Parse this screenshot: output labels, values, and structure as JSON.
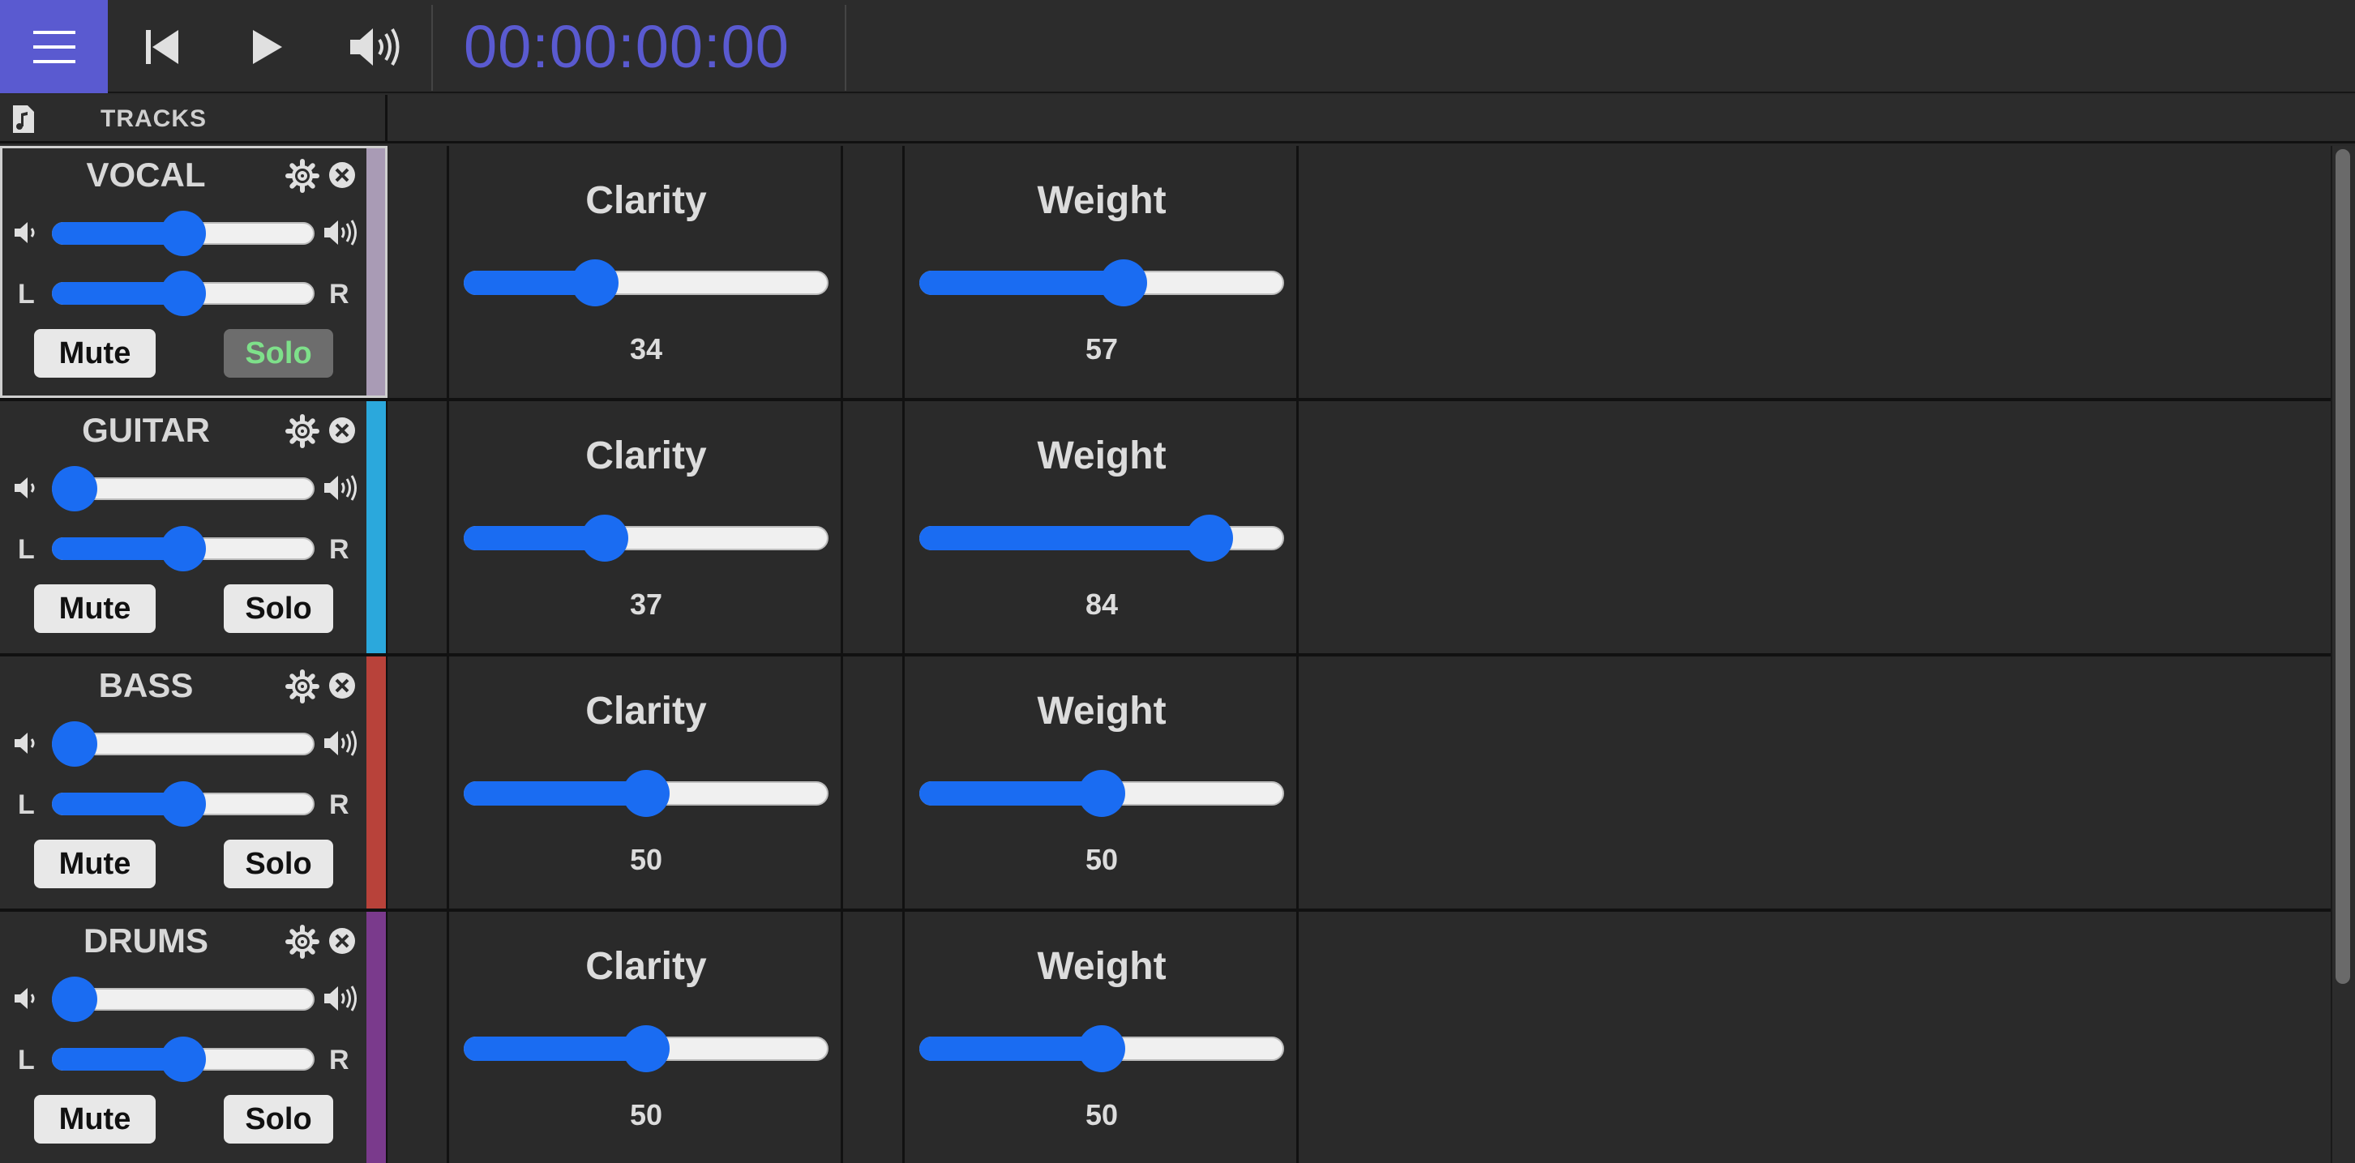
{
  "toolbar": {
    "menu_icon": "hamburger-icon",
    "skip_back_icon": "skip-back-icon",
    "play_icon": "play-icon",
    "volume_icon": "volume-icon",
    "timecode": "00:00:00:00",
    "accent": "#5a5ad0"
  },
  "header": {
    "tracks_icon": "music-file-icon",
    "tracks_label": "TRACKS"
  },
  "tracks": [
    {
      "name": "VOCAL",
      "color": "#a99bb5",
      "volume": 0.5,
      "pan": 0.5,
      "mute_label": "Mute",
      "solo_label": "Solo",
      "solo_active": true,
      "selected": true,
      "clarity": {
        "title": "Clarity",
        "value": "34",
        "level": 0.34
      },
      "weight": {
        "title": "Weight",
        "value": "57",
        "level": 0.57
      },
      "pan_left": "L",
      "pan_right": "R"
    },
    {
      "name": "GUITAR",
      "color": "#2ba8dc",
      "volume": 0.0,
      "pan": 0.5,
      "mute_label": "Mute",
      "solo_label": "Solo",
      "solo_active": false,
      "selected": false,
      "clarity": {
        "title": "Clarity",
        "value": "37",
        "level": 0.37
      },
      "weight": {
        "title": "Weight",
        "value": "84",
        "level": 0.84
      },
      "pan_left": "L",
      "pan_right": "R"
    },
    {
      "name": "BASS",
      "color": "#b8423a",
      "volume": 0.0,
      "pan": 0.5,
      "mute_label": "Mute",
      "solo_label": "Solo",
      "solo_active": false,
      "selected": false,
      "clarity": {
        "title": "Clarity",
        "value": "50",
        "level": 0.5
      },
      "weight": {
        "title": "Weight",
        "value": "50",
        "level": 0.5
      },
      "pan_left": "L",
      "pan_right": "R"
    },
    {
      "name": "DRUMS",
      "color": "#7a3a8c",
      "volume": 0.0,
      "pan": 0.5,
      "mute_label": "Mute",
      "solo_label": "Solo",
      "solo_active": false,
      "selected": false,
      "clarity": {
        "title": "Clarity",
        "value": "50",
        "level": 0.5
      },
      "weight": {
        "title": "Weight",
        "value": "50",
        "level": 0.5
      },
      "pan_left": "L",
      "pan_right": "R"
    }
  ]
}
